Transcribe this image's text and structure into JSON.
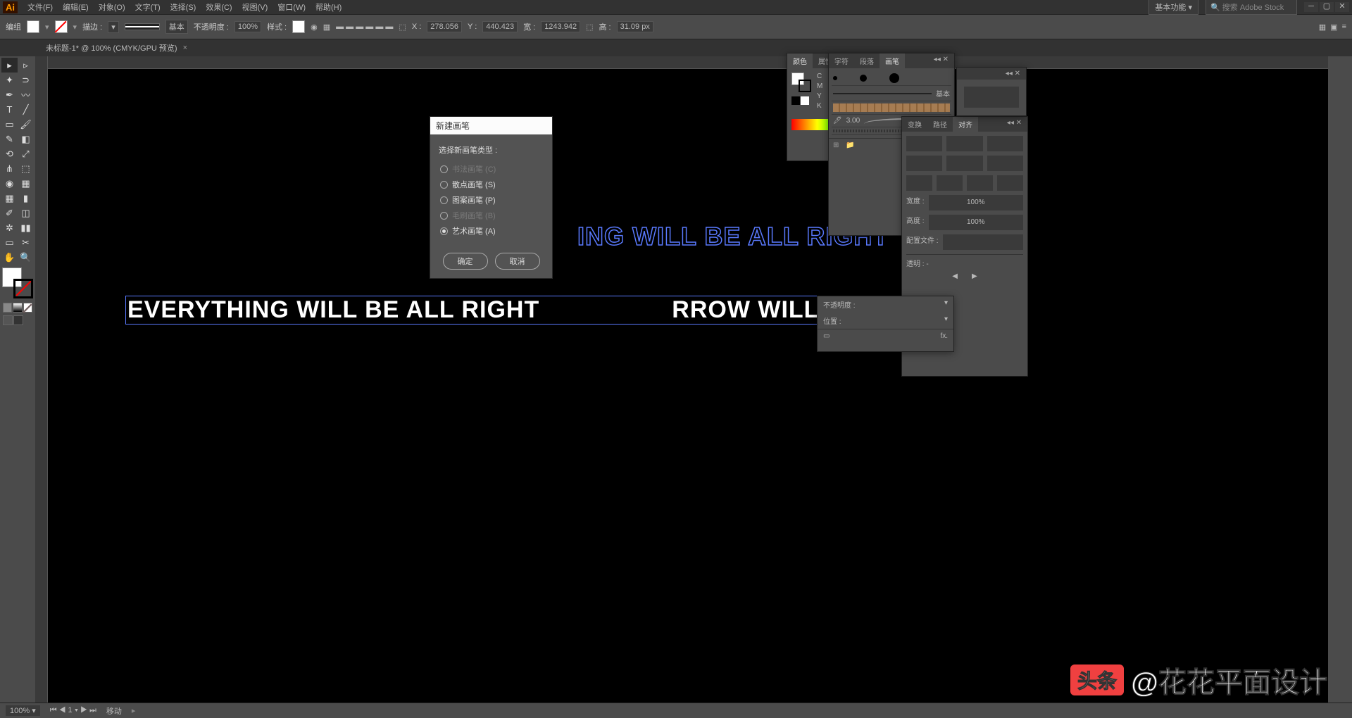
{
  "app": {
    "logo": "Ai"
  },
  "menu": [
    "文件(F)",
    "编辑(E)",
    "对象(O)",
    "文字(T)",
    "选择(S)",
    "效果(C)",
    "视图(V)",
    "窗口(W)",
    "帮助(H)"
  ],
  "workspace": "基本功能",
  "search_placeholder": "搜索 Adobe Stock",
  "ctrlbar": {
    "group": "编组",
    "stroke_label": "描边 :",
    "stroke_profile": "基本",
    "opacity_label": "不透明度 :",
    "opacity_value": "100%",
    "style_label": "样式 :",
    "x_label": "X :",
    "x_value": "278.056",
    "y_label": "Y :",
    "y_value": "440.423",
    "w_label": "宽 :",
    "w_value": "1243.942",
    "h_label": "高 :",
    "h_value": "31.09 px"
  },
  "doc_tab": "未标题-1* @ 100% (CMYK/GPU 预览)",
  "canvas": {
    "text_blue": "ING WILL BE ALL RIGHT",
    "text_white": "EVERYTHING WILL BE ALL RIGHT",
    "text_white2": "RROW WILL BE FINE"
  },
  "dialog": {
    "title": "新建画笔",
    "header": "选择新画笔类型 :",
    "options": [
      {
        "label": "书法画笔 (C)",
        "enabled": false,
        "selected": false
      },
      {
        "label": "散点画笔 (S)",
        "enabled": true,
        "selected": false
      },
      {
        "label": "图案画笔 (P)",
        "enabled": true,
        "selected": false
      },
      {
        "label": "毛刷画笔 (B)",
        "enabled": false,
        "selected": false
      },
      {
        "label": "艺术画笔 (A)",
        "enabled": true,
        "selected": true
      }
    ],
    "ok": "确定",
    "cancel": "取消"
  },
  "color_panel": {
    "tabs": [
      "颜色",
      "属性"
    ],
    "channels": [
      "C",
      "M",
      "Y",
      "K"
    ]
  },
  "brush_panel": {
    "tabs": [
      "字符",
      "段落",
      "画笔"
    ],
    "basic": "基本",
    "size": "3.00"
  },
  "trans_panel": {
    "tabs": [
      "变换",
      "路径",
      "对齐"
    ],
    "xlabel": "宽度 :",
    "x100": "100%",
    "ylabel": "高度 :",
    "y100": "100%",
    "profile": "配置文件 :",
    "transparency": "透明 : -"
  },
  "props_panel": {
    "r1": "不透明度 :",
    "r2": "位置 :"
  },
  "status": {
    "zoom": "100%",
    "artboard": "1",
    "tool": "移动"
  },
  "watermark": {
    "logo": "头条",
    "text": "@花花平面设计"
  }
}
